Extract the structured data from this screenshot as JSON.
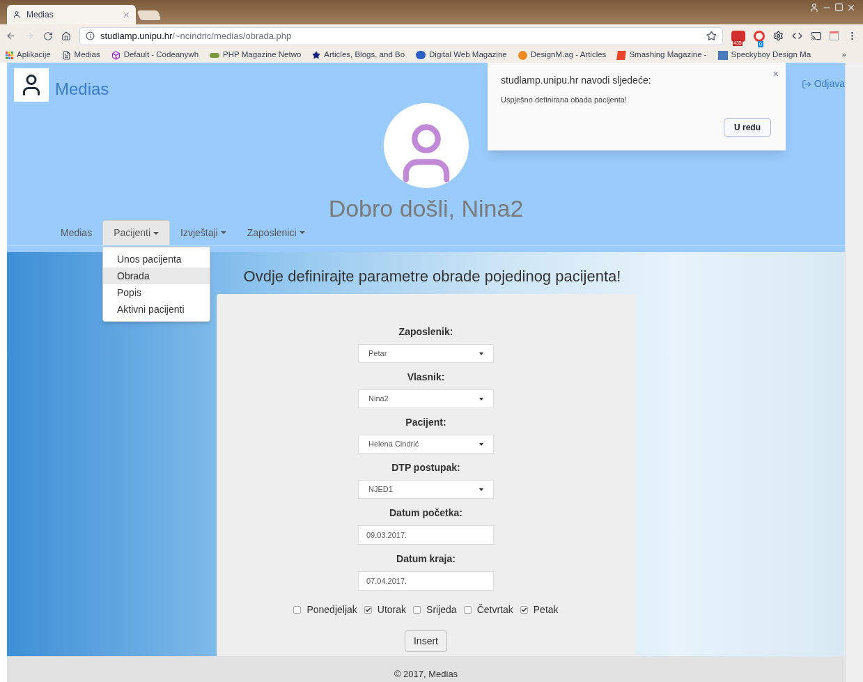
{
  "browser": {
    "tab_title": "Medias",
    "url_host": "studlamp.unipu.hr",
    "url_path": "/~ncindric/medias/obrada.php",
    "extension_badges": [
      "435",
      "0"
    ],
    "bookmarks": [
      {
        "label": "Aplikacije",
        "kind": "apps"
      },
      {
        "label": "Medias",
        "kind": "page"
      },
      {
        "label": "Default - Codeanywh",
        "kind": "cube"
      },
      {
        "label": "PHP Magazine Netwo",
        "kind": "php"
      },
      {
        "label": "Articles, Blogs, and Bo",
        "kind": "star"
      },
      {
        "label": "Digital Web Magazine",
        "kind": "d"
      },
      {
        "label": "DesignM.ag - Articles",
        "kind": "dm"
      },
      {
        "label": "Smashing Magazine -",
        "kind": "s"
      },
      {
        "label": "Speckyboy Design Ma",
        "kind": "bo"
      }
    ],
    "more": "»"
  },
  "header": {
    "brand": "Medias",
    "logout": "Odjava",
    "welcome": "Dobro došli, Nina2"
  },
  "nav": [
    {
      "label": "Medias",
      "dropdown": false,
      "selected": false
    },
    {
      "label": "Pacijenti",
      "dropdown": true,
      "selected": true
    },
    {
      "label": "Izvještaji",
      "dropdown": true,
      "selected": false
    },
    {
      "label": "Zaposlenici",
      "dropdown": true,
      "selected": false
    }
  ],
  "dropdown_menu": [
    {
      "label": "Unos pacijenta",
      "selected": false
    },
    {
      "label": "Obrada",
      "selected": true
    },
    {
      "label": "Popis",
      "selected": false
    },
    {
      "label": "Aktivni pacijenti",
      "selected": false
    }
  ],
  "alert": {
    "title": "studlamp.unipu.hr navodi sljedeće:",
    "message": "Uspješno definirana obada pacijenta!",
    "button": "U redu",
    "close": "×"
  },
  "form": {
    "heading": "Ovdje definirajte parametre obrade pojedinog pacijenta!",
    "fields": [
      {
        "label": "Zaposlenik:",
        "kind": "select",
        "value": "Petar"
      },
      {
        "label": "Vlasnik:",
        "kind": "select",
        "value": "Nina2"
      },
      {
        "label": "Pacijent:",
        "kind": "select",
        "value": "Helena Cindrić"
      },
      {
        "label": "DTP postupak:",
        "kind": "select",
        "value": "NJED1"
      },
      {
        "label": "Datum početka:",
        "kind": "text",
        "value": "09.03.2017."
      },
      {
        "label": "Datum kraja:",
        "kind": "text",
        "value": "07.04.2017."
      }
    ],
    "days": [
      {
        "label": "Ponedjeljak",
        "checked": false
      },
      {
        "label": "Utorak",
        "checked": true
      },
      {
        "label": "Srijeda",
        "checked": false
      },
      {
        "label": "Četvrtak",
        "checked": false
      },
      {
        "label": "Petak",
        "checked": true
      }
    ],
    "submit": "Insert"
  },
  "footer": "© 2017, Medias"
}
